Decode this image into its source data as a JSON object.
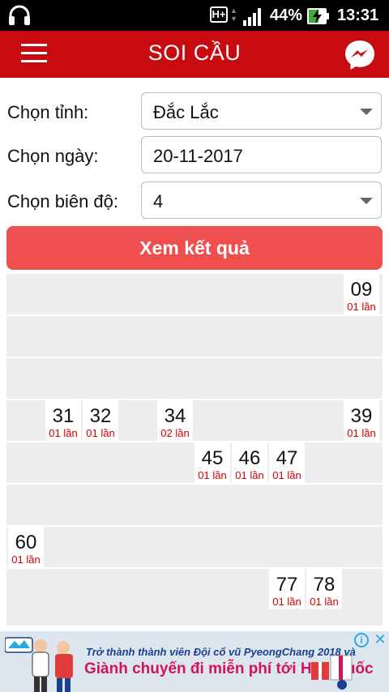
{
  "status_bar": {
    "network": "H+",
    "battery_percent": "44%",
    "time": "13:31"
  },
  "app_bar": {
    "title": "SOI CẦU",
    "menu_icon": "hamburger-menu-icon",
    "right_icon": "messenger-icon"
  },
  "form": {
    "province_label": "Chọn tỉnh:",
    "province_value": "Đắc Lắc",
    "date_label": "Chọn ngày:",
    "date_value": "20-11-2017",
    "amplitude_label": "Chọn biên độ:",
    "amplitude_value": "4"
  },
  "submit_label": "Xem kết quả",
  "results": [
    {
      "num": "09",
      "count": "01 lần"
    },
    {
      "num": "31",
      "count": "01 lần"
    },
    {
      "num": "32",
      "count": "01 lần"
    },
    {
      "num": "34",
      "count": "02 lần"
    },
    {
      "num": "39",
      "count": "01 lần"
    },
    {
      "num": "45",
      "count": "01 lần"
    },
    {
      "num": "46",
      "count": "01 lần"
    },
    {
      "num": "47",
      "count": "01 lần"
    },
    {
      "num": "60",
      "count": "01 lần"
    },
    {
      "num": "77",
      "count": "01 lần"
    },
    {
      "num": "78",
      "count": "01 lần"
    }
  ],
  "ad": {
    "line1": "Trở thành thành viên Đội cổ vũ PyeongChang 2018 và",
    "line2": "Giành chuyến đi miễn phí tới Hàn Quốc",
    "info_icon": "info-icon",
    "close_icon": "close-icon",
    "close_glyph": "✕",
    "info_glyph": "i"
  },
  "colors": {
    "app_bar": "#c70b10",
    "button": "#ef4f4f",
    "count_text": "#cc0000"
  }
}
